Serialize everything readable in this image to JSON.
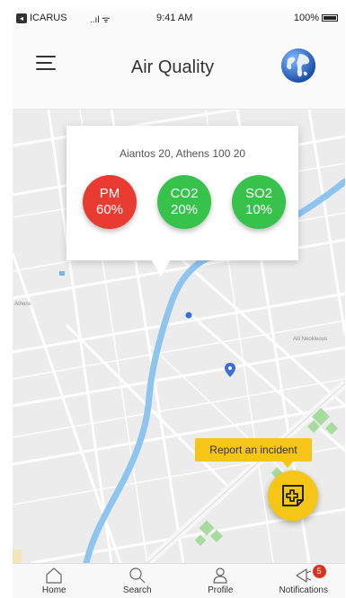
{
  "status_bar": {
    "carrier": "ICARUS",
    "signal": "..ıl ᯤ",
    "time": "9:41 AM",
    "battery": "100%"
  },
  "header": {
    "title": "Air Quality",
    "menu_icon": "hamburger-menu-icon",
    "globe_icon": "globe-icon"
  },
  "map": {
    "map_labels": [
      "Athens",
      "Alli Neokleous"
    ],
    "popup": {
      "address": "Aiantos 20, Athens 100 20",
      "metrics": [
        {
          "name": "PM",
          "value": "60%",
          "color": "#ea3b32"
        },
        {
          "name": "CO2",
          "value": "20%",
          "color": "#37c24b"
        },
        {
          "name": "SO2",
          "value": "10%",
          "color": "#37c24b"
        }
      ]
    }
  },
  "report": {
    "label": "Report an incident",
    "fab_icon": "add-report-icon"
  },
  "nav": {
    "items": [
      {
        "label": "Home",
        "icon": "home-icon"
      },
      {
        "label": "Search",
        "icon": "search-icon"
      },
      {
        "label": "Profile",
        "icon": "profile-icon"
      },
      {
        "label": "Notifications",
        "icon": "notifications-icon",
        "badge": "5"
      }
    ]
  },
  "colors": {
    "accent": "#f5c518",
    "danger": "#ea3b32",
    "good": "#37c24b",
    "river": "#8ec5ef"
  }
}
